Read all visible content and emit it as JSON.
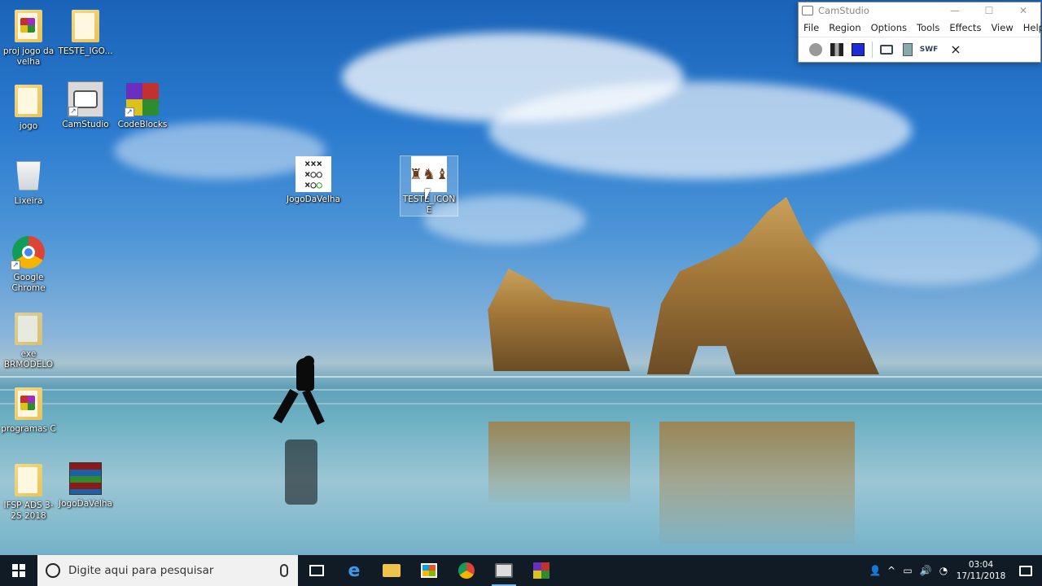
{
  "desktop": {
    "icons": [
      {
        "label": "proj jogo da velha"
      },
      {
        "label": "TESTE_IGO..."
      },
      {
        "label": "jogo"
      },
      {
        "label": "CamStudio"
      },
      {
        "label": "CodeBlocks"
      },
      {
        "label": "Lixeira"
      },
      {
        "label": "JogoDaVelha"
      },
      {
        "label": "TESTE_ICONE"
      },
      {
        "label": "Google Chrome"
      },
      {
        "label": "exe BRMODELO"
      },
      {
        "label": "programas C"
      },
      {
        "label": "IFSP ADS 3-2S 2018"
      },
      {
        "label": "JogoDaVelha"
      }
    ]
  },
  "camstudio": {
    "title": "CamStudio",
    "menu": [
      "File",
      "Region",
      "Options",
      "Tools",
      "Effects",
      "View",
      "Help"
    ],
    "toolbar_icons": [
      "record-icon",
      "pause-icon",
      "stop-icon",
      "annotate-icon",
      "video-icon",
      "swf-icon",
      "exit-icon"
    ]
  },
  "taskbar": {
    "search_placeholder": "Digite aqui para pesquisar",
    "clock_time": "03:04",
    "clock_date": "17/11/2018",
    "pinned": [
      "task-view-icon",
      "edge-icon",
      "file-explorer-icon",
      "store-icon",
      "chrome-icon",
      "camstudio-icon",
      "codeblocks-icon"
    ]
  },
  "colors": {
    "taskbar_bg": "#101b26",
    "accent_underline": "#76b9ed"
  }
}
